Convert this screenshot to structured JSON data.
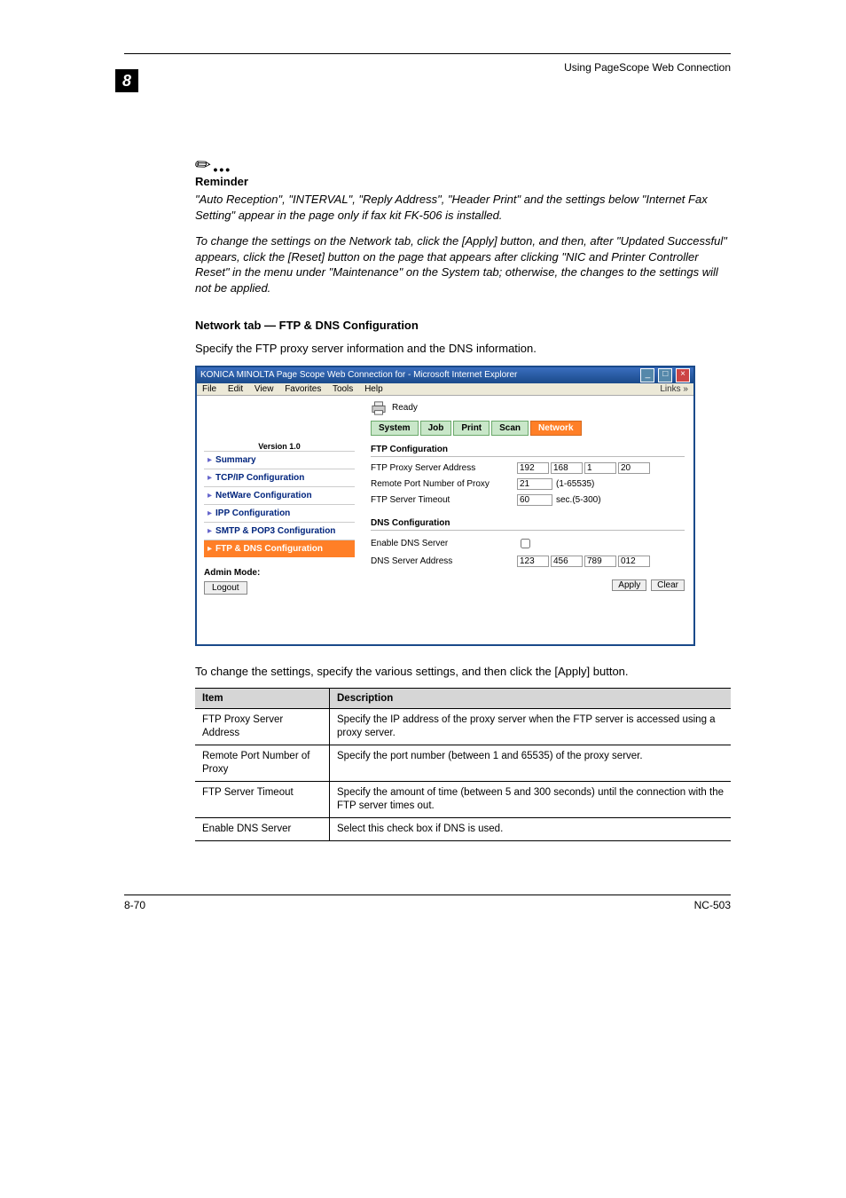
{
  "header": {
    "right": "Using PageScope Web Connection",
    "chapter": "8"
  },
  "reminder": {
    "label": "Reminder",
    "p1": "\"Auto Reception\", \"INTERVAL\", \"Reply Address\", \"Header Print\" and the settings below \"Internet Fax Setting\" appear in the page only if fax kit FK-506 is installed.",
    "p2": "To change the settings on the Network tab, click the [Apply] button, and then, after \"Updated Successful\" appears, click the [Reset] button on the page that appears after clicking \"NIC and Printer Controller Reset\" in the menu under \"Maintenance\" on the System tab; otherwise, the changes to the settings will not be applied."
  },
  "section": {
    "heading": "Network tab — FTP & DNS Configuration",
    "intro": "Specify the FTP proxy server information and the DNS information.",
    "outro": "To change the settings, specify the various settings, and then click the [Apply] button."
  },
  "shot": {
    "title": "KONICA MINOLTA Page Scope Web Connection for         - Microsoft Internet Explorer",
    "menu": [
      "File",
      "Edit",
      "View",
      "Favorites",
      "Tools",
      "Help"
    ],
    "links_label": "Links »",
    "version": "Version 1.0",
    "nav": [
      {
        "label": "Summary",
        "sel": false
      },
      {
        "label": "TCP/IP Configuration",
        "sel": false
      },
      {
        "label": "NetWare Configuration",
        "sel": false
      },
      {
        "label": "IPP Configuration",
        "sel": false
      },
      {
        "label": "SMTP & POP3 Configuration",
        "sel": false
      },
      {
        "label": "FTP & DNS Configuration",
        "sel": true
      }
    ],
    "admin_label": "Admin Mode:",
    "logout": "Logout",
    "ready": "Ready",
    "tabs": [
      "System",
      "Job",
      "Print",
      "Scan",
      "Network"
    ],
    "active_tab": 4,
    "ftp_h": "FTP Configuration",
    "rows": {
      "proxy_addr_label": "FTP Proxy Server Address",
      "proxy_addr": [
        "192",
        "168",
        "1",
        "20"
      ],
      "port_label": "Remote Port Number of Proxy",
      "port_val": "21",
      "port_range": "(1-65535)",
      "timeout_label": "FTP Server Timeout",
      "timeout_val": "60",
      "timeout_unit": "sec.(5-300)"
    },
    "dns_h": "DNS Configuration",
    "dns": {
      "enable_label": "Enable DNS Server",
      "addr_label": "DNS Server Address",
      "addr": [
        "123",
        "456",
        "789",
        "012"
      ]
    },
    "btn_apply": "Apply",
    "btn_clear": "Clear"
  },
  "table": {
    "h1": "Item",
    "h2": "Description",
    "rows": [
      {
        "item": "FTP Proxy Server Address",
        "desc": "Specify the IP address of the proxy server when the FTP server is accessed using a proxy server."
      },
      {
        "item": "Remote Port Number of Proxy",
        "desc": "Specify the port number (between 1 and 65535) of the proxy server."
      },
      {
        "item": "FTP Server Timeout",
        "desc": "Specify the amount of time (between 5 and 300 seconds) until the connection with the FTP server times out."
      },
      {
        "item": "Enable DNS Server",
        "desc": "Select this check box if DNS is used."
      }
    ]
  },
  "footer": {
    "left": "8-70",
    "right": "NC-503"
  }
}
